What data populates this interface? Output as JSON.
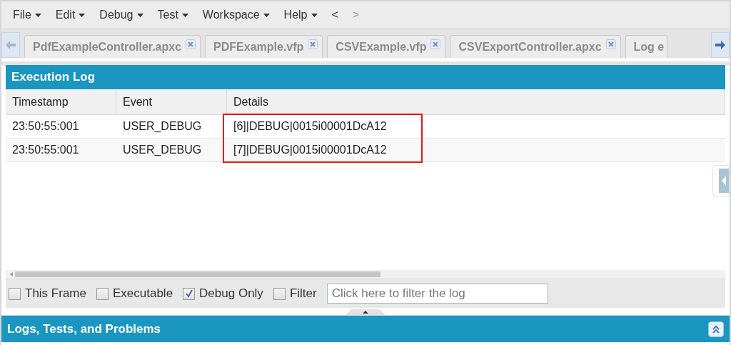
{
  "menu": [
    {
      "label": "File",
      "dropdown": true,
      "disabled": false
    },
    {
      "label": "Edit",
      "dropdown": true,
      "disabled": false
    },
    {
      "label": "Debug",
      "dropdown": true,
      "disabled": false
    },
    {
      "label": "Test",
      "dropdown": true,
      "disabled": false
    },
    {
      "label": "Workspace",
      "dropdown": true,
      "disabled": false
    },
    {
      "label": "Help",
      "dropdown": true,
      "disabled": false
    },
    {
      "label": "<",
      "dropdown": false,
      "disabled": false
    },
    {
      "label": ">",
      "dropdown": false,
      "disabled": true
    }
  ],
  "tabs": [
    {
      "label": "PdfExampleController.apxc"
    },
    {
      "label": "PDFExample.vfp"
    },
    {
      "label": "CSVExample.vfp"
    },
    {
      "label": "CSVExportController.apxc"
    }
  ],
  "cut_tab": {
    "label": "Log e"
  },
  "execution_log": {
    "title": "Execution Log",
    "columns": [
      "Timestamp",
      "Event",
      "Details"
    ],
    "rows": [
      {
        "timestamp": "23:50:55:001",
        "event": "USER_DEBUG",
        "details": "[6]|DEBUG|0015i00001DcA12",
        "highlighted": true
      },
      {
        "timestamp": "23:50:55:001",
        "event": "USER_DEBUG",
        "details": "[7]|DEBUG|0015i00001DcA12",
        "highlighted": true
      }
    ],
    "filters": [
      {
        "label": "This Frame",
        "checked": false
      },
      {
        "label": "Executable",
        "checked": false
      },
      {
        "label": "Debug Only",
        "checked": true
      },
      {
        "label": "Filter",
        "checked": false
      }
    ],
    "filter_field": {
      "placeholder": "Click here to filter the log"
    }
  },
  "bottom_panel": {
    "title": "Logs, Tests, and Problems"
  }
}
